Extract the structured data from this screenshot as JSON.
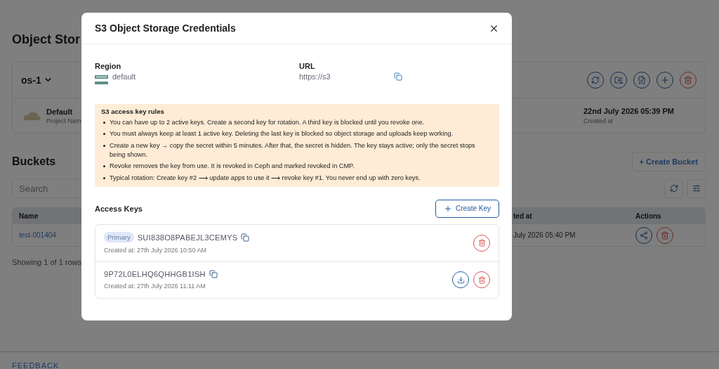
{
  "page": {
    "title": "Object Stor",
    "storage": {
      "name": "os-1",
      "project": "Default",
      "project_label": "Project Nam",
      "created": "22nd July 2026 05:39 PM",
      "created_label": "Created at"
    },
    "buckets_title": "Buckets",
    "create_bucket": "+ Create Bucket",
    "search": {
      "placeholder": "Search"
    },
    "table": {
      "columns": [
        "Name",
        "ted at",
        "Actions"
      ],
      "rows": [
        {
          "name": "test-001404",
          "column_2": "July 2026 05:40 PM"
        }
      ]
    },
    "row_count": "Showing 1 of 1 rows",
    "footer_link": "FEEDBACK"
  },
  "dialog": {
    "title": "S3 Object Storage Credentials",
    "region": {
      "label": "Region",
      "value": "default"
    },
    "url": {
      "label": "URL",
      "value": "https://s3"
    },
    "rules": {
      "title": "S3 access key rules",
      "items": [
        "You can have up to 2 active keys. Create a second key for rotation. A third key is blocked until you revoke one.",
        "You must always keep at least 1 active key. Deleting the last key is blocked so object storage and uploads keep working.",
        "Create a new key → copy the secret within 5 minutes. After that, the secret is hidden. The key stays active; only the secret stops being shown.",
        "Revoke removes the key from use. It is revoked in Ceph and marked revoked in CMP.",
        "Typical rotation: Create key #2 ⟶ update apps to use it ⟶ revoke key #1. You never end up with zero keys."
      ]
    },
    "keys_title": "Access Keys",
    "create_key": "Create Key",
    "keys": [
      {
        "badge": "Primary",
        "key": "SUI838O8PABEJL3CEMYS",
        "created": "Created at: 27th July 2026 10:50 AM",
        "download": false
      },
      {
        "key": "9P72L0ELHQ6QHHGB1ISH",
        "created": "Created at: 27th July 2026 11:11 AM",
        "download": true
      }
    ]
  }
}
